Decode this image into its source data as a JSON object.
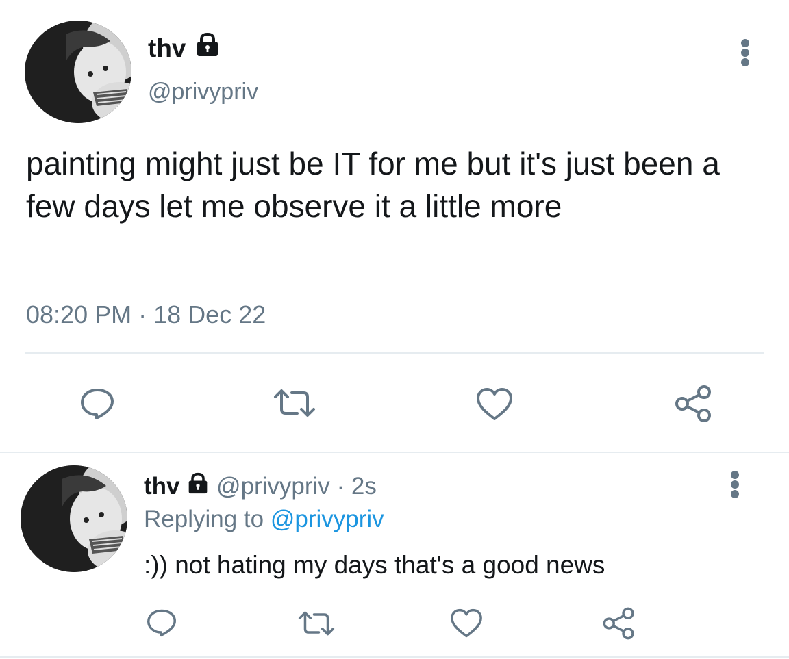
{
  "main_tweet": {
    "author_name": "thv",
    "handle": "@privypriv",
    "text": "painting might just be IT for me but it's just been a few days let me observe it a little more",
    "time": "08:20 PM",
    "separator": "·",
    "date": "18 Dec 22"
  },
  "reply_tweet": {
    "author_name": "thv",
    "handle": "@privypriv",
    "age": "· 2s",
    "replying_to_prefix": "Replying to",
    "replying_to_handle": "@privypriv",
    "text": ":)) not hating my days that's a good news"
  },
  "actions": [
    "reply-icon",
    "retweet-icon",
    "like-icon",
    "share-icon"
  ],
  "colors": {
    "text": "#14171a",
    "muted": "#657786",
    "link": "#1b95e0",
    "divider": "#e6ecf0"
  }
}
